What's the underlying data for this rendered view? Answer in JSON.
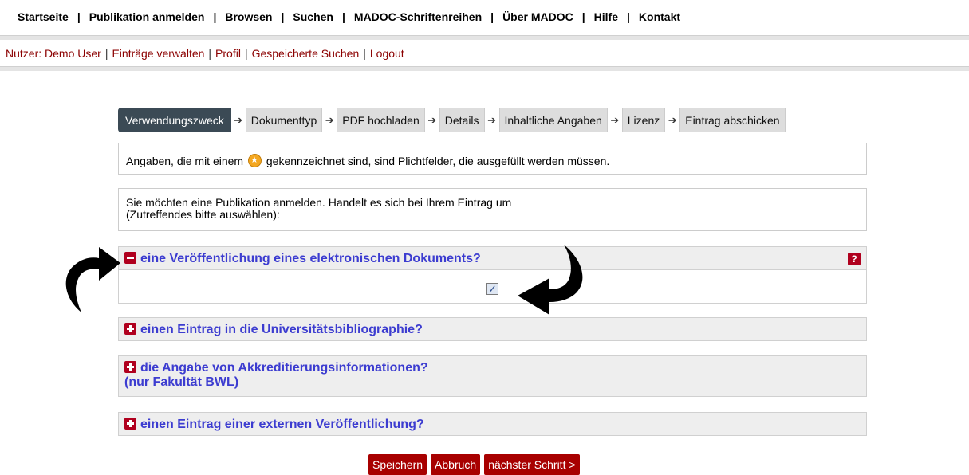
{
  "topnav": {
    "items": [
      "Startseite",
      "Publikation anmelden",
      "Browsen",
      "Suchen",
      "MADOC-Schriftenreihen",
      "Über MADOC",
      "Hilfe",
      "Kontakt"
    ],
    "separator": "|"
  },
  "usernav": {
    "user": "Nutzer: Demo User",
    "items": [
      "Einträge verwalten",
      "Profil",
      "Gespeicherte Suchen",
      "Logout"
    ],
    "separator": "|"
  },
  "steps": [
    "Verwendungszweck",
    "Dokumenttyp",
    "PDF hochladen",
    "Details",
    "Inhaltliche Angaben",
    "Lizenz",
    "Eintrag abschicken"
  ],
  "info": {
    "before": "Angaben, die mit einem",
    "after": "gekennzeichnet sind, sind Plichtfelder, die ausgefüllt werden müssen."
  },
  "intro": {
    "line1": "Sie möchten eine Publikation anmelden. Handelt es sich bei Ihrem Eintrag um",
    "line2": "(Zutreffendes bitte auswählen):"
  },
  "sections": [
    {
      "title": "eine Veröffentlichung eines elektronischen Dokuments?",
      "expanded": true,
      "checked": true,
      "help": "?"
    },
    {
      "title": "einen Eintrag in die Universitätsbibliographie?",
      "expanded": false
    },
    {
      "title": "die Angabe von Akkreditierungsinformationen?",
      "title2": "(nur Fakultät BWL)",
      "expanded": false
    },
    {
      "title": "einen Eintrag einer externen Veröffentlichung?",
      "expanded": false
    }
  ],
  "buttons": {
    "save": "Speichern",
    "cancel": "Abbruch",
    "next": "nächster Schritt >"
  },
  "colors": {
    "accent": "#a80000",
    "link": "#3c3cd0",
    "active_step": "#3b4a55"
  }
}
